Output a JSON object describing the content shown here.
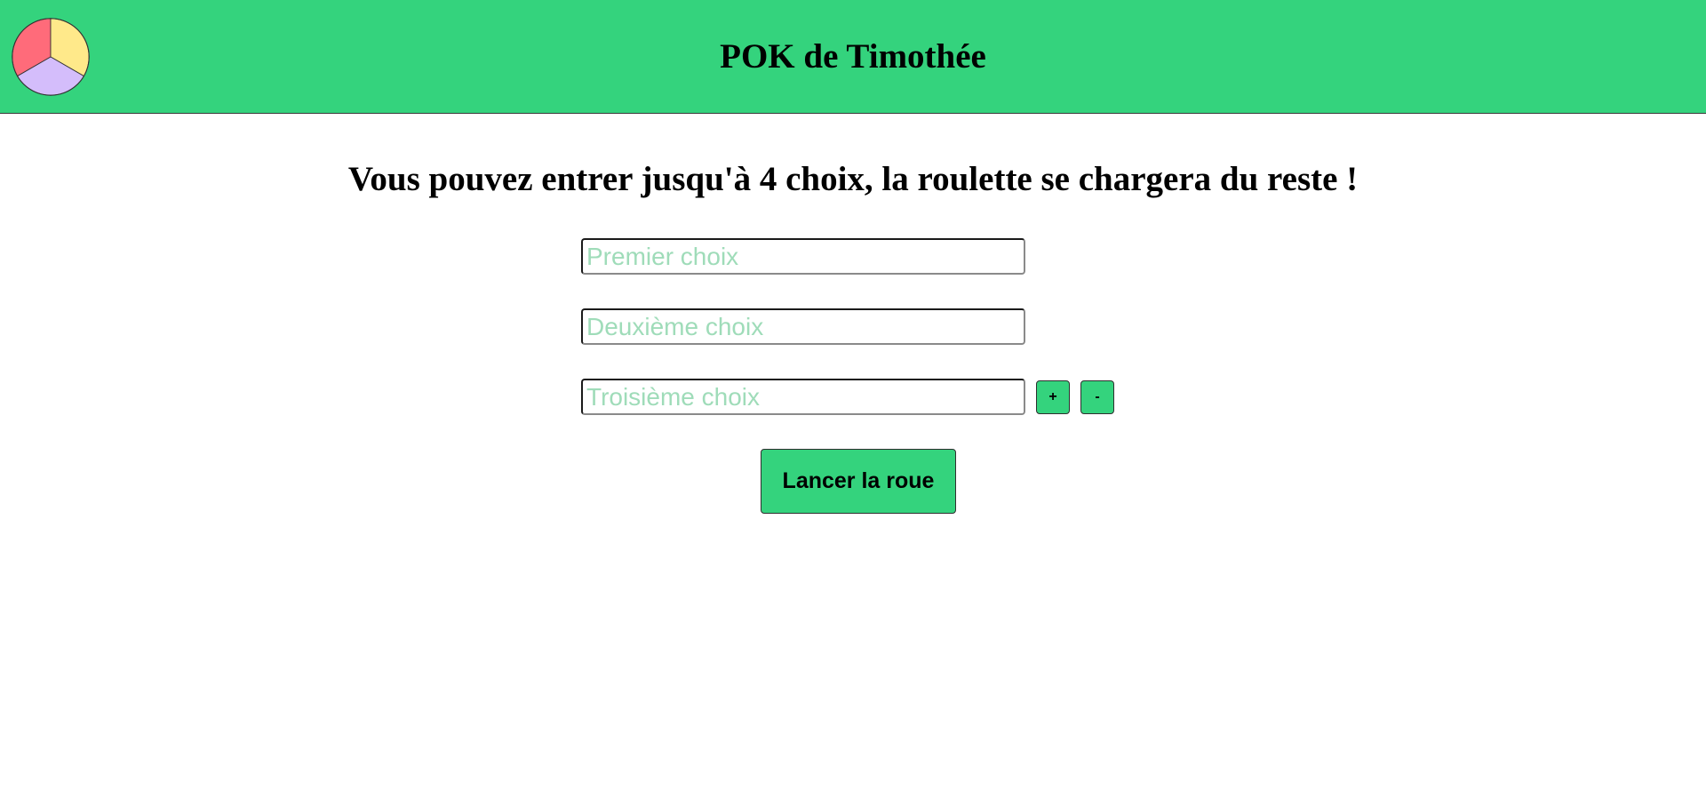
{
  "header": {
    "title": "POK de Timothée",
    "logo": {
      "icon": "wheel-logo-icon",
      "segment_colors": [
        "#ff6b7a",
        "#ffe98a",
        "#d4bdfb"
      ]
    },
    "background_color": "#34d37d"
  },
  "main": {
    "instructions": "Vous pouvez entrer jusqu'à 4 choix, la roulette se chargera du reste !",
    "choices": [
      {
        "value": "",
        "placeholder": "Premier choix"
      },
      {
        "value": "",
        "placeholder": "Deuxième choix"
      },
      {
        "value": "",
        "placeholder": "Troisième choix"
      }
    ],
    "add_label": "+",
    "remove_label": "-",
    "spin_label": "Lancer la roue"
  },
  "colors": {
    "accent": "#34d37d",
    "placeholder": "#9fdcb9"
  }
}
